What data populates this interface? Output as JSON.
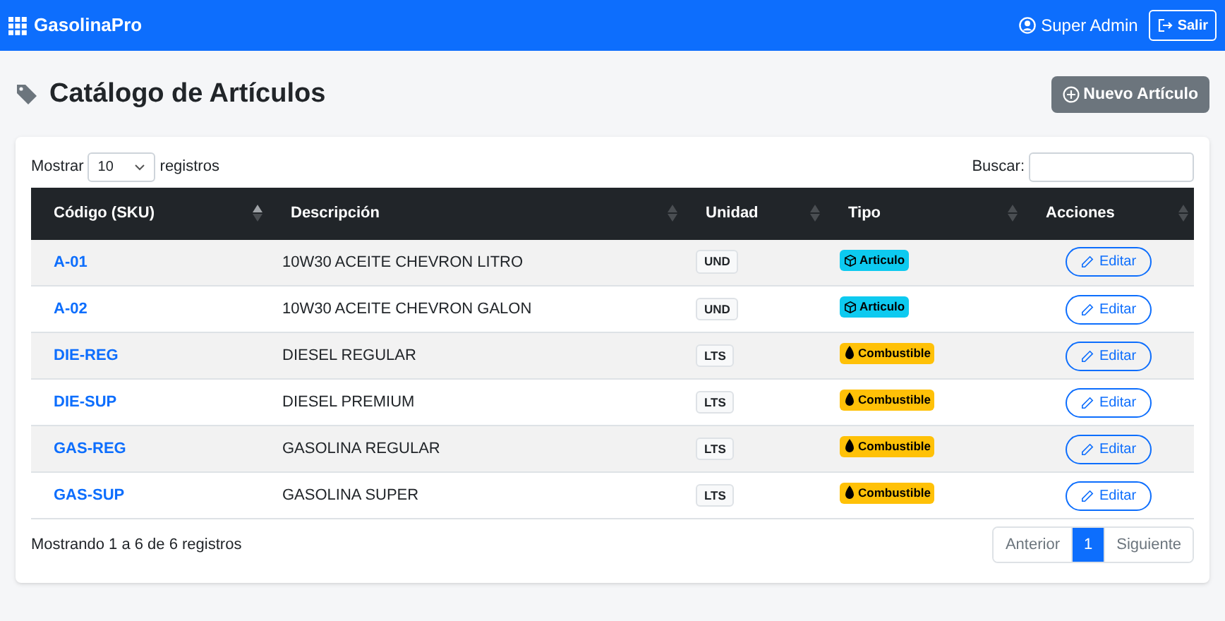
{
  "navbar": {
    "brand": "GasolinaPro",
    "user": "Super Admin",
    "logout": "Salir"
  },
  "page": {
    "title": "Catálogo de Artículos",
    "new_button": "Nuevo Artículo"
  },
  "table_controls": {
    "show_label": "Mostrar",
    "page_size": "10",
    "records_label": "registros",
    "search_label": "Buscar:"
  },
  "table": {
    "columns": [
      {
        "label": "Código (SKU)",
        "sorted": true
      },
      {
        "label": "Descripción",
        "sorted": false
      },
      {
        "label": "Unidad",
        "sorted": false
      },
      {
        "label": "Tipo",
        "sorted": false
      },
      {
        "label": "Acciones",
        "sorted": false
      }
    ],
    "rows": [
      {
        "sku": "A-01",
        "description": "10W30 ACEITE CHEVRON LITRO",
        "unit": "UND",
        "type": {
          "kind": "articulo",
          "label": "Articulo"
        },
        "action": "Editar"
      },
      {
        "sku": "A-02",
        "description": "10W30 ACEITE CHEVRON GALON",
        "unit": "UND",
        "type": {
          "kind": "articulo",
          "label": "Articulo"
        },
        "action": "Editar"
      },
      {
        "sku": "DIE-REG",
        "description": "DIESEL REGULAR",
        "unit": "LTS",
        "type": {
          "kind": "combustible",
          "label": "Combustible"
        },
        "action": "Editar"
      },
      {
        "sku": "DIE-SUP",
        "description": "DIESEL PREMIUM",
        "unit": "LTS",
        "type": {
          "kind": "combustible",
          "label": "Combustible"
        },
        "action": "Editar"
      },
      {
        "sku": "GAS-REG",
        "description": "GASOLINA REGULAR",
        "unit": "LTS",
        "type": {
          "kind": "combustible",
          "label": "Combustible"
        },
        "action": "Editar"
      },
      {
        "sku": "GAS-SUP",
        "description": "GASOLINA SUPER",
        "unit": "LTS",
        "type": {
          "kind": "combustible",
          "label": "Combustible"
        },
        "action": "Editar"
      }
    ]
  },
  "footer": {
    "info": "Mostrando 1 a 6 de 6 registros",
    "pagination": [
      {
        "label": "Anterior",
        "selected": false
      },
      {
        "label": "1",
        "selected": true
      },
      {
        "label": "Siguiente",
        "selected": false
      }
    ]
  }
}
